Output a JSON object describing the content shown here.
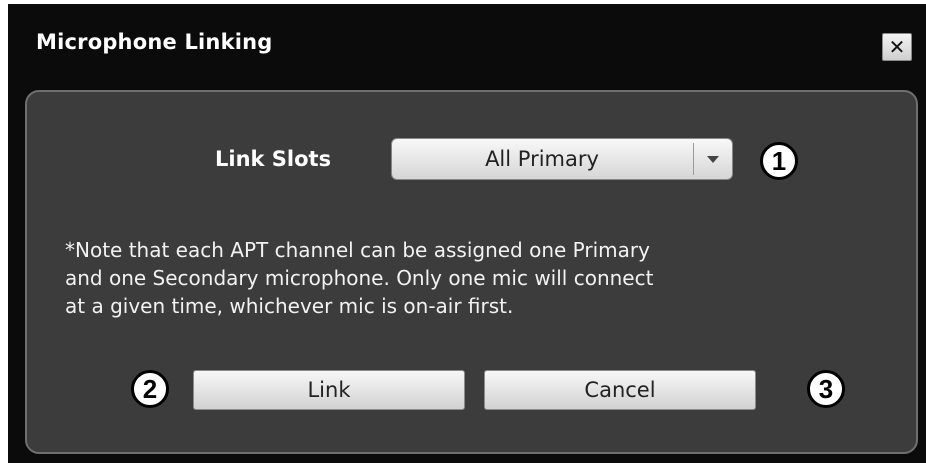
{
  "dialog": {
    "title": "Microphone Linking",
    "close_label": "✕"
  },
  "link_slots": {
    "label": "Link Slots",
    "selected": "All Primary"
  },
  "note": {
    "lines": [
      "*Note that each APT channel can be assigned one Primary",
      "and one Secondary microphone. Only one mic will connect",
      "at a given time, whichever mic is on-air first."
    ]
  },
  "buttons": {
    "link": "Link",
    "cancel": "Cancel"
  },
  "callouts": [
    "1",
    "2",
    "3"
  ],
  "colors": {
    "titlebar": "#0b0b0b",
    "panel": "#3c3c3c",
    "panel_border": "#6f6f6f",
    "text": "#ffffff"
  }
}
